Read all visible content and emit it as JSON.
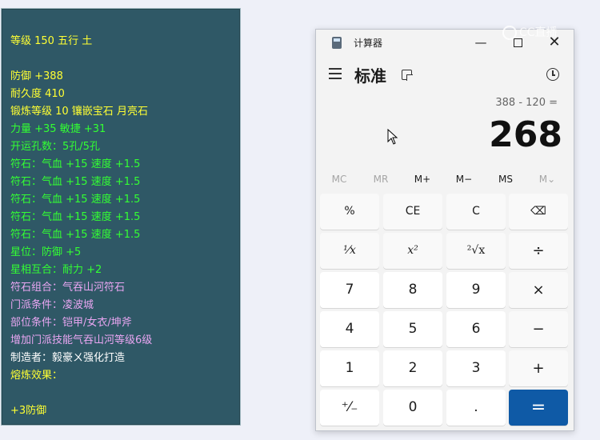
{
  "tooltip": {
    "lines": [
      {
        "text": "等级 150 五行 土",
        "color": "#ffff33"
      },
      {
        "text": "防御 +388",
        "color": "#ffff33"
      },
      {
        "text": "耐久度 410",
        "color": "#ffff33"
      },
      {
        "text": "锻炼等级 10 镶嵌宝石 月亮石",
        "color": "#ffff33"
      },
      {
        "text": "力量 +35 敏捷 +31",
        "color": "#33ff33"
      },
      {
        "text": "开运孔数：5孔/5孔",
        "color": "#33ff33"
      },
      {
        "text": "符石：气血 +15 速度 +1.5",
        "color": "#33ff33"
      },
      {
        "text": "符石：气血 +15 速度 +1.5",
        "color": "#33ff33"
      },
      {
        "text": "符石：气血 +15 速度 +1.5",
        "color": "#33ff33"
      },
      {
        "text": "符石：气血 +15 速度 +1.5",
        "color": "#33ff33"
      },
      {
        "text": "符石：气血 +15 速度 +1.5",
        "color": "#33ff33"
      },
      {
        "text": "星位：防御 +5",
        "color": "#33ff33"
      },
      {
        "text": "星相互合：耐力 +2",
        "color": "#33ff33"
      },
      {
        "text": "符石组合：气吞山河符石",
        "color": "#e9a6f2"
      },
      {
        "text": "门派条件：凌波城",
        "color": "#e9a6f2"
      },
      {
        "text": "部位条件：铠甲/女衣/坤斧",
        "color": "#e9a6f2"
      },
      {
        "text": "增加门派技能气吞山河等级6级",
        "color": "#e9a6f2"
      },
      {
        "text": "制造者：毅豪ㄨ强化打造",
        "color": "#ffffff"
      },
      {
        "text": "熔炼效果：",
        "color": "#ffff33"
      },
      {
        "text": "+3防御",
        "color": "#ffff33"
      }
    ]
  },
  "calculator": {
    "window_title": "计算器",
    "mode": "标准",
    "expression": "388 - 120 =",
    "display": "268",
    "memory": [
      "MC",
      "MR",
      "M+",
      "M−",
      "MS",
      "M⌄"
    ],
    "keys": [
      [
        "%",
        "CE",
        "C",
        "⌫"
      ],
      [
        "¹⁄x",
        "x²",
        "²√x",
        "÷"
      ],
      [
        "7",
        "8",
        "9",
        "×"
      ],
      [
        "4",
        "5",
        "6",
        "−"
      ],
      [
        "1",
        "2",
        "3",
        "+"
      ],
      [
        "⁺⁄₋",
        "0",
        ".",
        "="
      ]
    ],
    "accent_color": "#0f5aa6"
  },
  "watermark": {
    "text": "CC直播"
  }
}
